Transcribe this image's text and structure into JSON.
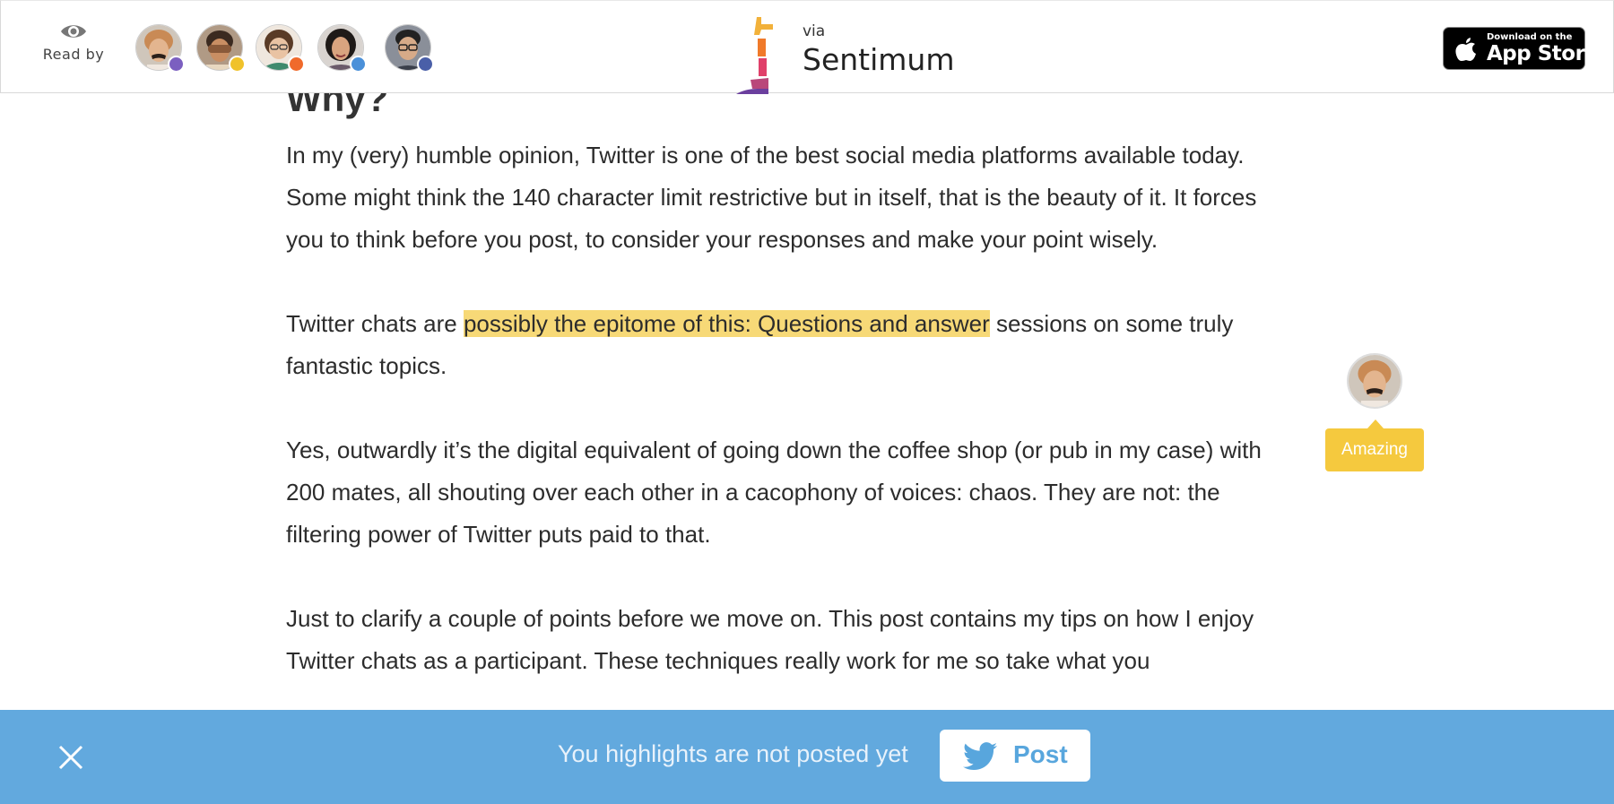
{
  "header": {
    "read_by_label": "Read by",
    "readers": [
      {
        "name": "reader-1",
        "badge_color": "#7b5fc0",
        "skin": "#e3b58f",
        "hair": "#c98a55",
        "bg": "#cfc6bb"
      },
      {
        "name": "reader-2",
        "badge_color": "#f0c22a",
        "skin": "#c98e63",
        "hair": "#3b2a20",
        "bg": "#b09a85"
      },
      {
        "name": "reader-3",
        "badge_color": "#f06a2b",
        "skin": "#e9c3a3",
        "hair": "#5a3b26",
        "bg": "#3f8a6d"
      },
      {
        "name": "reader-4",
        "badge_color": "#4a90d9",
        "skin": "#d9a47f",
        "hair": "#1f1a18",
        "bg": "#6a5a6a"
      },
      {
        "name": "reader-5",
        "badge_color": "#4a5fa8",
        "skin": "#d6aa88",
        "hair": "#222222",
        "bg": "#8a8f99"
      }
    ],
    "brand_via": "via",
    "brand_name": "Sentimum",
    "appstore_small": "Download on the",
    "appstore_big": "App Store"
  },
  "article": {
    "heading": "Why?",
    "paragraphs": {
      "p1": "In my (very) humble opinion, Twitter is one of the best social media platforms available today. Some might think the 140 character limit restrictive but in itself, that is the beauty of it. It forces you to think before you post, to consider your responses and make your point wisely.",
      "p2_before": "Twitter chats are ",
      "p2_highlight": "possibly the epitome of this: Questions and answer",
      "p2_after": " sessions on some truly fantastic topics.",
      "p3": "Yes, outwardly it’s the digital equivalent of going down the coffee shop (or pub in my case) with 200 mates, all shouting over each other in a cacophony of voices: chaos. They are not: the filtering power of Twitter puts paid to that.",
      "p4": "Just to clarify a couple of points before we move on. This post contains my tips on how I enjoy Twitter chats as a participant. These techniques really work for me so take what you"
    },
    "highlight_color": "#f7d977"
  },
  "annotation": {
    "tag_label": "Amazing",
    "tag_color": "#f5c93e"
  },
  "bottom_bar": {
    "message": "You highlights are not posted yet",
    "post_label": "Post",
    "bar_color": "#62a9de"
  }
}
